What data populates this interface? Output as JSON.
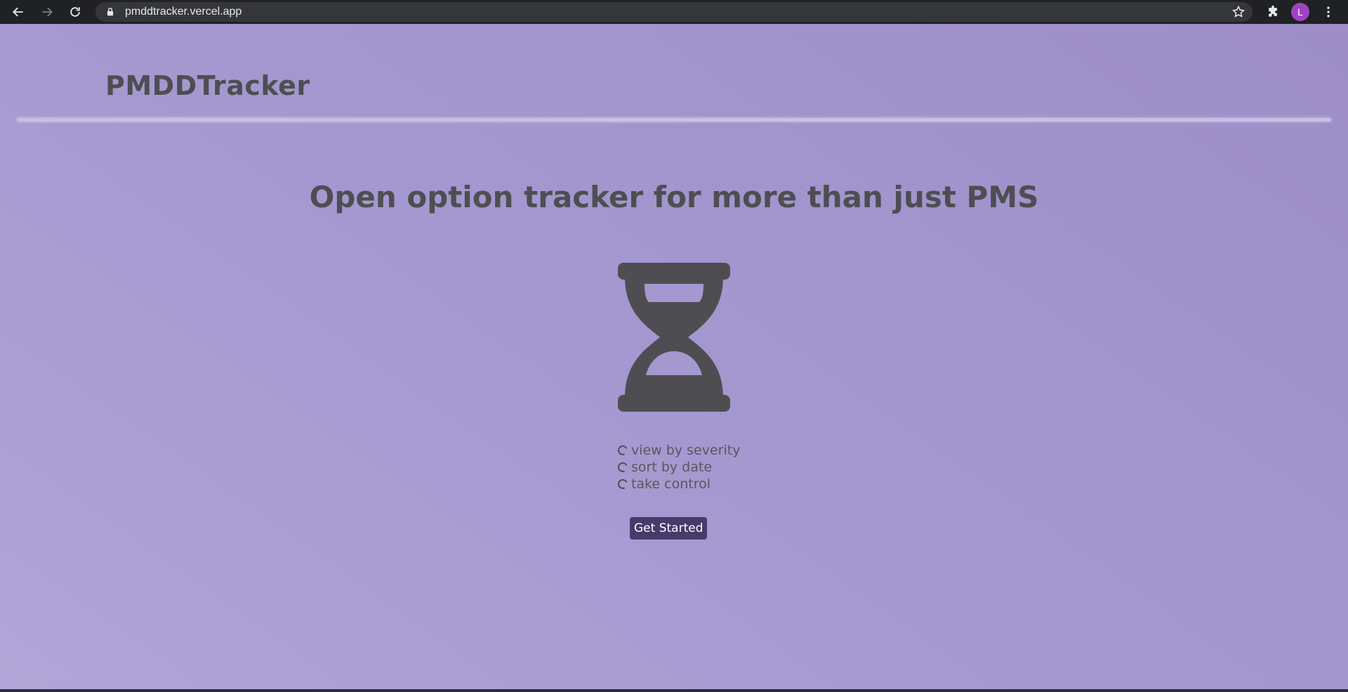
{
  "browser": {
    "url": "pmddtracker.vercel.app",
    "profile_initial": "L",
    "profile_color": "#a142c4"
  },
  "header": {
    "brand": "PMDDTracker"
  },
  "main": {
    "headline": "Open option tracker for more than just PMS",
    "features": [
      {
        "label": "view by severity"
      },
      {
        "label": "sort by date"
      },
      {
        "label": "take control"
      }
    ],
    "cta_label": "Get Started"
  },
  "colors": {
    "background": "#a598d0",
    "text": "#4e4e52",
    "button": "#473b6b"
  },
  "icons": [
    "back-icon",
    "forward-icon",
    "reload-icon",
    "lock-icon",
    "star-icon",
    "extensions-icon",
    "menu-icon",
    "hourglass-icon",
    "spinner-icon"
  ]
}
